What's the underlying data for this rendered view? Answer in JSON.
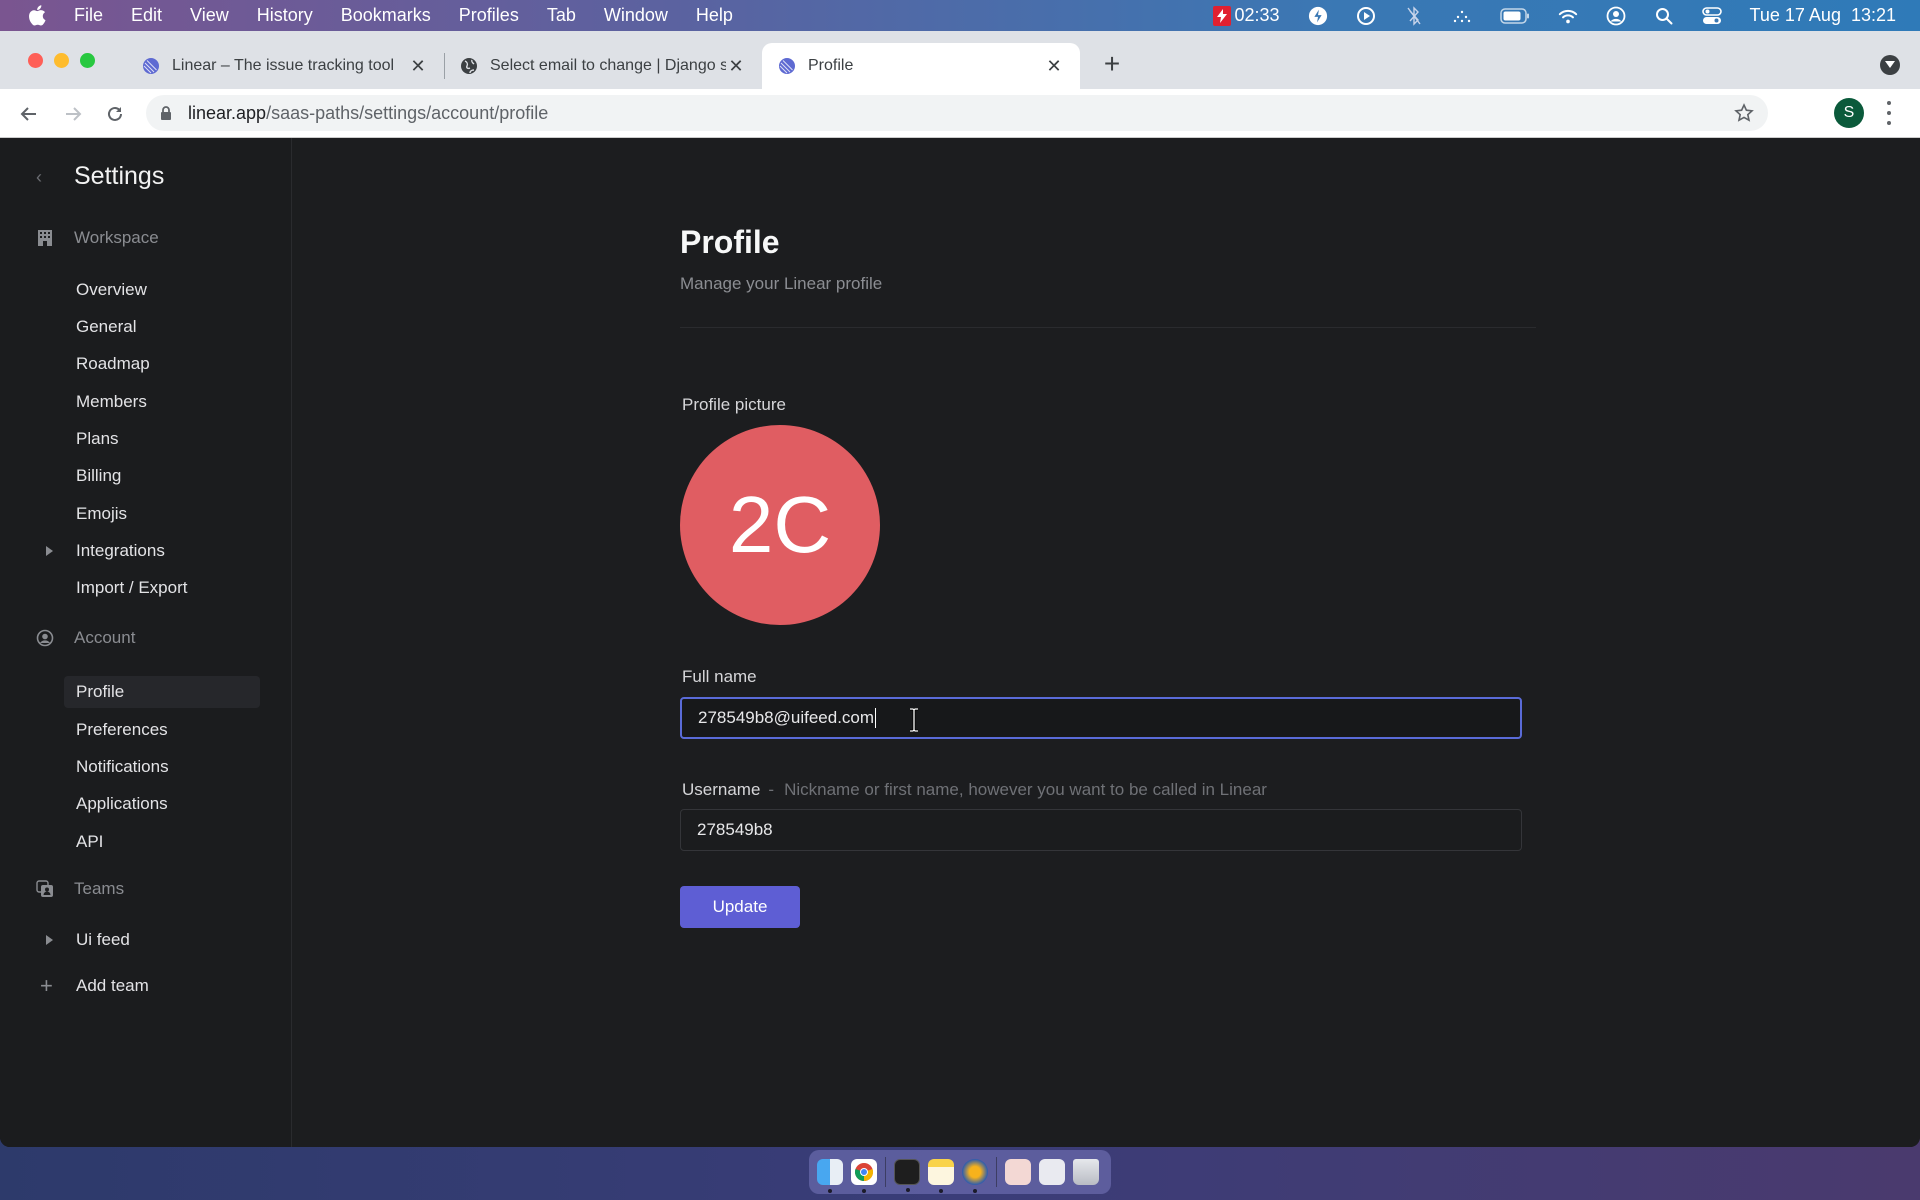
{
  "menubar": {
    "app_name": "Chrome",
    "items": [
      "File",
      "Edit",
      "View",
      "History",
      "Bookmarks",
      "Profiles",
      "Tab",
      "Window",
      "Help"
    ],
    "recording_time": "02:33",
    "datetime": "Tue 17 Aug  13:21",
    "status_icons": [
      "recording-icon",
      "bolt-icon",
      "play-icon",
      "bluetooth-off-icon",
      "wifi-dots-icon",
      "battery-icon",
      "wifi-icon",
      "user-icon",
      "spotlight-search-icon",
      "control-center-icon"
    ]
  },
  "browser": {
    "tabs": [
      {
        "title": "Linear – The issue tracking tool",
        "favicon": "linear-icon",
        "active": false
      },
      {
        "title": "Select email to change | Django site admin",
        "favicon": "globe-icon",
        "active": false
      },
      {
        "title": "Profile",
        "favicon": "linear-icon",
        "active": true
      }
    ],
    "url_host": "linear.app",
    "url_path": "/saas-paths/settings/account/profile",
    "profile_initial": "S",
    "profile_color": "#0b5a3b"
  },
  "sidebar": {
    "title": "Settings",
    "sections": [
      {
        "label": "Workspace",
        "icon": "building-icon",
        "items": [
          {
            "label": "Overview"
          },
          {
            "label": "General"
          },
          {
            "label": "Roadmap"
          },
          {
            "label": "Members"
          },
          {
            "label": "Plans"
          },
          {
            "label": "Billing"
          },
          {
            "label": "Emojis"
          },
          {
            "label": "Integrations",
            "expandable": true
          },
          {
            "label": "Import / Export"
          }
        ]
      },
      {
        "label": "Account",
        "icon": "user-circle-icon",
        "items": [
          {
            "label": "Profile",
            "active": true
          },
          {
            "label": "Preferences"
          },
          {
            "label": "Notifications"
          },
          {
            "label": "Applications"
          },
          {
            "label": "API"
          }
        ]
      },
      {
        "label": "Teams",
        "icon": "teams-icon",
        "items": [
          {
            "label": "Ui feed",
            "expandable": true
          }
        ]
      }
    ],
    "add_team_label": "Add team"
  },
  "main": {
    "title": "Profile",
    "subtitle": "Manage your Linear profile",
    "profile_picture_label": "Profile picture",
    "avatar_initials": "2C",
    "avatar_color": "#e05d62",
    "full_name_label": "Full name",
    "full_name_value": "278549b8@uifeed.com",
    "username_label": "Username",
    "username_hint": "Nickname or first name, however you want to be called in Linear",
    "username_value": "278549b8",
    "update_label": "Update",
    "accent_color": "#5e5ed4"
  },
  "dock": {
    "apps": [
      "finder-icon",
      "chrome-icon",
      "terminal-icon",
      "notes-icon",
      "reeder-icon",
      "preview-doc-icon",
      "screenshot-icon",
      "trash-icon"
    ]
  }
}
